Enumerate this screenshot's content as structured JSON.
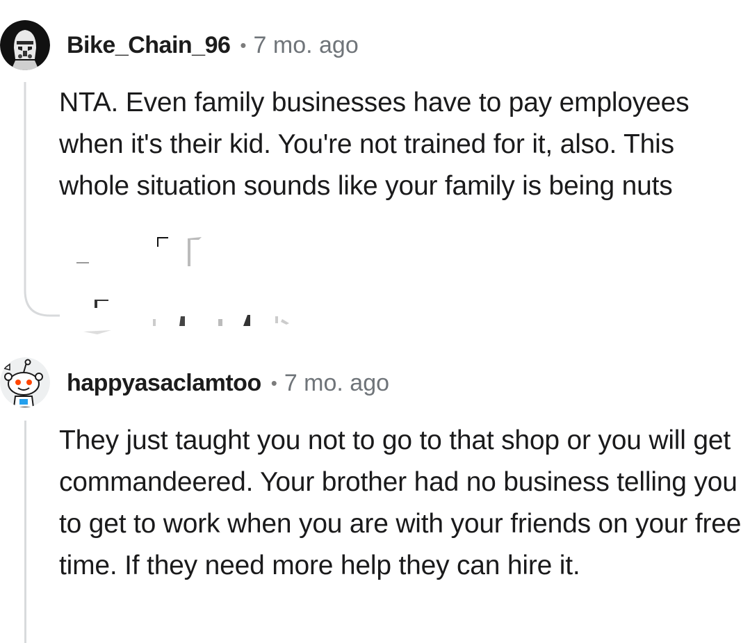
{
  "comments": [
    {
      "username": "Bike_Chain_96",
      "separator": "•",
      "age": "7 mo. ago",
      "avatar_icon": "stormtrooper-avatar-icon",
      "text": "NTA. Even family businesses have to pay employees when it's their kid. You're not trained for it, also. This whole situation sounds like your family is being nuts"
    },
    {
      "username": "happyasaclamtoo",
      "separator": "•",
      "age": "7 mo. ago",
      "avatar_icon": "snoo-avatar-icon",
      "text": "They just taught you not to go to that shop or you will get commandeered. Your brother had no business telling you to get to work when you are with your friends on your free time. If they need more help they can hire it."
    }
  ],
  "colors": {
    "username": "#1c1c1c",
    "meta": "#6f7479",
    "thread_line": "#d8dadc",
    "text": "#1a1a1b"
  }
}
